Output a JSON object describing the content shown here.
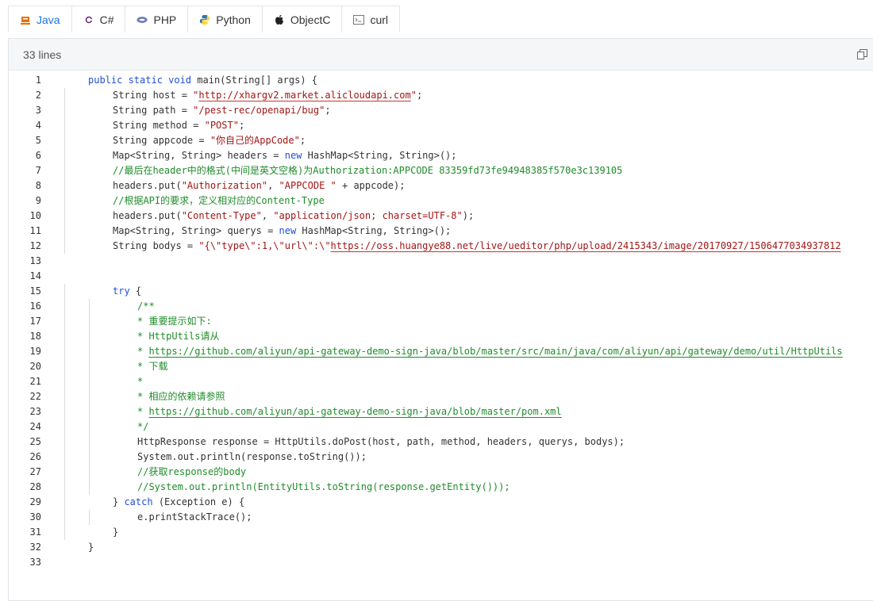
{
  "tabs": [
    {
      "label": "Java",
      "icon": "java-icon",
      "active": true
    },
    {
      "label": "C#",
      "icon": "csharp-icon",
      "active": false
    },
    {
      "label": "PHP",
      "icon": "php-icon",
      "active": false
    },
    {
      "label": "Python",
      "icon": "python-icon",
      "active": false
    },
    {
      "label": "ObjectC",
      "icon": "apple-icon",
      "active": false
    },
    {
      "label": "curl",
      "icon": "terminal-icon",
      "active": false
    }
  ],
  "panel": {
    "lines_label": "33 lines",
    "copy_icon": "copy-icon"
  },
  "colors": {
    "keyword": "#1f4fd6",
    "string": "#a31515",
    "comment": "#1f8c2a",
    "active_tab": "#1a73e8"
  },
  "code_lines": [
    {
      "n": "1",
      "indent": 1,
      "segs": [
        [
          "kw",
          "public static void "
        ],
        [
          "",
          "main(String[] args) {"
        ]
      ]
    },
    {
      "n": "2",
      "indent": 2,
      "segs": [
        [
          "",
          "String host = "
        ],
        [
          "str",
          "\""
        ],
        [
          "url-str",
          "http://xhargv2.market.alicloudapi.com"
        ],
        [
          "str",
          "\""
        ],
        [
          "",
          ";"
        ]
      ]
    },
    {
      "n": "3",
      "indent": 2,
      "segs": [
        [
          "",
          "String path = "
        ],
        [
          "str",
          "\"/pest-rec/openapi/bug\""
        ],
        [
          "",
          ";"
        ]
      ]
    },
    {
      "n": "4",
      "indent": 2,
      "segs": [
        [
          "",
          "String method = "
        ],
        [
          "str",
          "\"POST\""
        ],
        [
          "",
          ";"
        ]
      ]
    },
    {
      "n": "5",
      "indent": 2,
      "segs": [
        [
          "",
          "String appcode = "
        ],
        [
          "str",
          "\"你自己的AppCode\""
        ],
        [
          "",
          ";"
        ]
      ]
    },
    {
      "n": "6",
      "indent": 2,
      "segs": [
        [
          "",
          "Map<String, String> headers = "
        ],
        [
          "kw",
          "new "
        ],
        [
          "",
          "HashMap<String, String>();"
        ]
      ]
    },
    {
      "n": "7",
      "indent": 2,
      "segs": [
        [
          "com",
          "//最后在header中的格式(中间是英文空格)为Authorization:APPCODE 83359fd73fe94948385f570e3c139105"
        ]
      ]
    },
    {
      "n": "8",
      "indent": 2,
      "segs": [
        [
          "",
          "headers.put("
        ],
        [
          "str",
          "\"Authorization\""
        ],
        [
          "",
          ", "
        ],
        [
          "str",
          "\"APPCODE \""
        ],
        [
          "",
          " + appcode);"
        ]
      ]
    },
    {
      "n": "9",
      "indent": 2,
      "segs": [
        [
          "com",
          "//根据API的要求，定义相对应的Content-Type"
        ]
      ]
    },
    {
      "n": "10",
      "indent": 2,
      "segs": [
        [
          "",
          "headers.put("
        ],
        [
          "str",
          "\"Content-Type\""
        ],
        [
          "",
          ", "
        ],
        [
          "str",
          "\"application/json; charset=UTF-8\""
        ],
        [
          "",
          ");"
        ]
      ]
    },
    {
      "n": "11",
      "indent": 2,
      "segs": [
        [
          "",
          "Map<String, String> querys = "
        ],
        [
          "kw",
          "new "
        ],
        [
          "",
          "HashMap<String, String>();"
        ]
      ]
    },
    {
      "n": "12",
      "indent": 2,
      "segs": [
        [
          "",
          "String bodys = "
        ],
        [
          "str",
          "\"{\\\"type\\\":1,\\\"url\\\":\\\""
        ],
        [
          "url-str",
          "https://oss.huangye88.net/live/ueditor/php/upload/2415343/image/20170927/1506477034937812"
        ]
      ]
    },
    {
      "n": "13",
      "indent": 0,
      "segs": []
    },
    {
      "n": "14",
      "indent": 0,
      "segs": []
    },
    {
      "n": "15",
      "indent": 2,
      "segs": [
        [
          "kw",
          "try "
        ],
        [
          "",
          "{"
        ]
      ]
    },
    {
      "n": "16",
      "indent": 3,
      "segs": [
        [
          "com",
          "/**"
        ]
      ]
    },
    {
      "n": "17",
      "indent": 3,
      "segs": [
        [
          "com",
          "* 重要提示如下:"
        ]
      ]
    },
    {
      "n": "18",
      "indent": 3,
      "segs": [
        [
          "com",
          "* HttpUtils请从"
        ]
      ]
    },
    {
      "n": "19",
      "indent": 3,
      "segs": [
        [
          "com",
          "* "
        ],
        [
          "url-com",
          "https://github.com/aliyun/api-gateway-demo-sign-java/blob/master/src/main/java/com/aliyun/api/gateway/demo/util/HttpUtils"
        ]
      ]
    },
    {
      "n": "20",
      "indent": 3,
      "segs": [
        [
          "com",
          "* 下载"
        ]
      ]
    },
    {
      "n": "21",
      "indent": 3,
      "segs": [
        [
          "com",
          "*"
        ]
      ]
    },
    {
      "n": "22",
      "indent": 3,
      "segs": [
        [
          "com",
          "* 相应的依赖请参照"
        ]
      ]
    },
    {
      "n": "23",
      "indent": 3,
      "segs": [
        [
          "com",
          "* "
        ],
        [
          "url-com",
          "https://github.com/aliyun/api-gateway-demo-sign-java/blob/master/pom.xml"
        ]
      ]
    },
    {
      "n": "24",
      "indent": 3,
      "segs": [
        [
          "com",
          "*/"
        ]
      ]
    },
    {
      "n": "25",
      "indent": 3,
      "segs": [
        [
          "",
          "HttpResponse response = HttpUtils.doPost(host, path, method, headers, querys, bodys);"
        ]
      ]
    },
    {
      "n": "26",
      "indent": 3,
      "segs": [
        [
          "",
          "System.out.println(response.toString());"
        ]
      ]
    },
    {
      "n": "27",
      "indent": 3,
      "segs": [
        [
          "com",
          "//获取response的body"
        ]
      ]
    },
    {
      "n": "28",
      "indent": 3,
      "segs": [
        [
          "com",
          "//System.out.println(EntityUtils.toString(response.getEntity()));"
        ]
      ]
    },
    {
      "n": "29",
      "indent": 2,
      "segs": [
        [
          "",
          "} "
        ],
        [
          "kw",
          "catch "
        ],
        [
          "",
          "(Exception e) {"
        ]
      ]
    },
    {
      "n": "30",
      "indent": 3,
      "segs": [
        [
          "",
          "e.printStackTrace();"
        ]
      ]
    },
    {
      "n": "31",
      "indent": 2,
      "segs": [
        [
          "",
          "}"
        ]
      ]
    },
    {
      "n": "32",
      "indent": 1,
      "segs": [
        [
          "",
          "}"
        ]
      ]
    },
    {
      "n": "33",
      "indent": 0,
      "segs": []
    }
  ]
}
